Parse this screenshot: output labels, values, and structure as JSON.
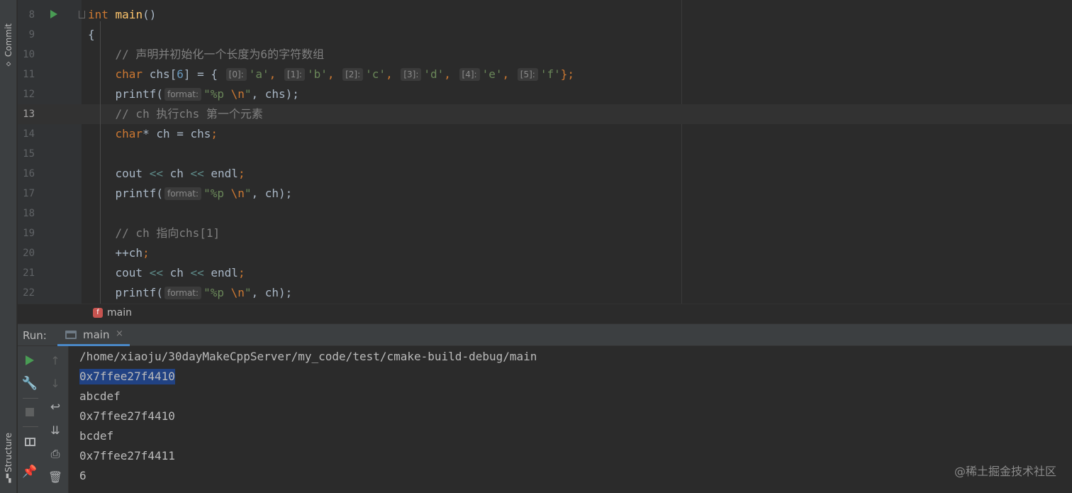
{
  "left_strip": {
    "commit_label": "Commit",
    "structure_label": "Structure"
  },
  "editor": {
    "hints": {
      "format": "format:",
      "idx0": "[0]:",
      "idx1": "[1]:",
      "idx2": "[2]:",
      "idx3": "[3]:",
      "idx4": "[4]:",
      "idx5": "[5]:"
    },
    "lines": [
      {
        "number": "8",
        "parts": {
          "a": "int",
          "b": "main",
          "c": "()"
        }
      },
      {
        "number": "9",
        "parts": {
          "a": "{"
        }
      },
      {
        "number": "10",
        "parts": {
          "a": "    // 声明并初始化一个长度为6的字符数组"
        }
      },
      {
        "number": "11",
        "parts": {
          "a": "    ",
          "b": "char",
          "c": " chs[",
          "d": "6",
          "e": "] = { ",
          "f": "'a'",
          "g": ", ",
          "h": "'b'",
          "i": ", ",
          "j": "'c'",
          "k": ", ",
          "l": "'d'",
          "m": ", ",
          "n": "'e'",
          "o": ", ",
          "p": "'f'",
          "q": "};"
        }
      },
      {
        "number": "12",
        "parts": {
          "a": "    printf(",
          "b": "\"%p ",
          "c": "\\n",
          "d": "\"",
          "e": ", chs);"
        }
      },
      {
        "number": "13",
        "parts": {
          "a": "    // ch 执行chs 第一个元素"
        }
      },
      {
        "number": "14",
        "parts": {
          "a": "    ",
          "b": "char",
          "c": "* ch = chs",
          "d": ";"
        }
      },
      {
        "number": "15",
        "parts": {}
      },
      {
        "number": "16",
        "parts": {
          "a": "    cout ",
          "b": "<<",
          "c": " ch ",
          "d": "<<",
          "e": " endl",
          "f": ";"
        }
      },
      {
        "number": "17",
        "parts": {
          "a": "    printf(",
          "b": "\"%p ",
          "c": "\\n",
          "d": "\"",
          "e": ", ch);"
        }
      },
      {
        "number": "18",
        "parts": {}
      },
      {
        "number": "19",
        "parts": {
          "a": "    // ch 指向chs[1]"
        }
      },
      {
        "number": "20",
        "parts": {
          "a": "    ++ch",
          "b": ";"
        }
      },
      {
        "number": "21",
        "parts": {
          "a": "    cout ",
          "b": "<<",
          "c": " ch ",
          "d": "<<",
          "e": " endl",
          "f": ";"
        }
      },
      {
        "number": "22",
        "parts": {
          "a": "    printf(",
          "b": "\"%p ",
          "c": "\\n",
          "d": "\"",
          "e": ", ch);"
        }
      }
    ]
  },
  "breadcrumb": {
    "badge": "f",
    "label": "main"
  },
  "run_panel": {
    "label": "Run:",
    "tab_label": "main",
    "tab_close": "×",
    "output": [
      "/home/xiaoju/30dayMakeCppServer/my_code/test/cmake-build-debug/main",
      "0x7ffee27f4410",
      "abcdef",
      "0x7ffee27f4410",
      "bcdef",
      "0x7ffee27f4411",
      "6"
    ]
  },
  "icons": {
    "rerun": "play-icon",
    "settings": "wrench-icon",
    "stop": "stop-icon",
    "layout": "layout-icon",
    "pin": "pin-icon",
    "up": "arrow-up-icon",
    "down": "arrow-down-icon",
    "soft_wrap": "soft-wrap-icon",
    "scroll_end": "scroll-to-end-icon",
    "print": "print-icon",
    "clear": "trash-icon"
  },
  "watermark": "@稀土掘金技术社区"
}
